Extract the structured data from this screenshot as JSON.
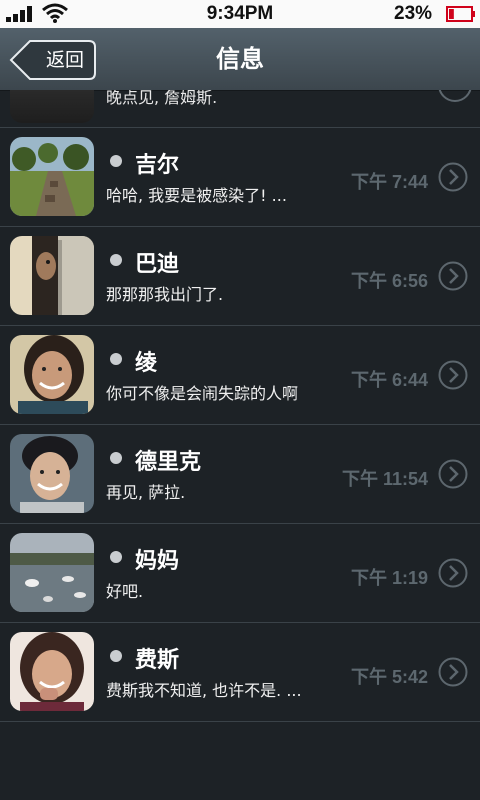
{
  "status_bar": {
    "time": "9:34PM",
    "battery_percent_text": "23%",
    "battery_level": 0.23
  },
  "nav": {
    "back_label": "返回",
    "title": "信息"
  },
  "partial_row": {
    "preview": "晚点见, 詹姆斯."
  },
  "messages": [
    {
      "name": "吉尔",
      "preview": "哈哈, 我要是被感染了! ...",
      "time": "下午 7:44",
      "avatar": "landscape-ruins"
    },
    {
      "name": "巴迪",
      "preview": "那那那我出门了.",
      "time": "下午 6:56",
      "avatar": "person-behind-door"
    },
    {
      "name": "绫",
      "preview": "你可不像是会闹失踪的人啊",
      "time": "下午 6:44",
      "avatar": "smiling-woman"
    },
    {
      "name": "德里克",
      "preview": "再见, 萨拉.",
      "time": "下午 11:54",
      "avatar": "smiling-man"
    },
    {
      "name": "妈妈",
      "preview": "好吧.",
      "time": "下午 1:19",
      "avatar": "lake-swans"
    },
    {
      "name": "费斯",
      "preview": "费斯我不知道, 也许不是. ...",
      "time": "下午 5:42",
      "avatar": "laughing-woman"
    }
  ],
  "colors": {
    "background": "#1d2226",
    "navbar": "#4a565e",
    "time_text": "#5d686f",
    "battery_low": "#d0021b"
  }
}
